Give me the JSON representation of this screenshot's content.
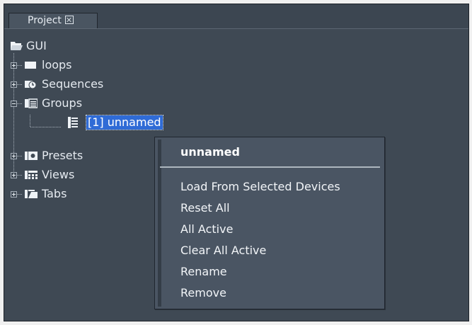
{
  "panel": {
    "tab_label": "Project"
  },
  "tree": {
    "root_label": "GUI",
    "items": [
      {
        "label": "loops",
        "icon": "folder-icon",
        "expanded": false
      },
      {
        "label": "Sequences",
        "icon": "sequence-icon",
        "expanded": false
      },
      {
        "label": "Groups",
        "icon": "group-icon",
        "expanded": true
      },
      {
        "label": "Presets",
        "icon": "preset-icon",
        "expanded": false
      },
      {
        "label": "Views",
        "icon": "views-icon",
        "expanded": false
      },
      {
        "label": "Tabs",
        "icon": "tabs-icon",
        "expanded": false
      }
    ],
    "group_child": {
      "label": "[1] unnamed",
      "icon": "group-item-icon",
      "selected": true
    }
  },
  "context_menu": {
    "title": "unnamed",
    "items": [
      "Load From Selected Devices",
      "Reset All",
      "All Active",
      "Clear All Active",
      "Rename",
      "Remove"
    ]
  },
  "colors": {
    "panel_bg": "#3f4954",
    "selection": "#2f6bd6",
    "menu_bg": "#4a5563"
  }
}
